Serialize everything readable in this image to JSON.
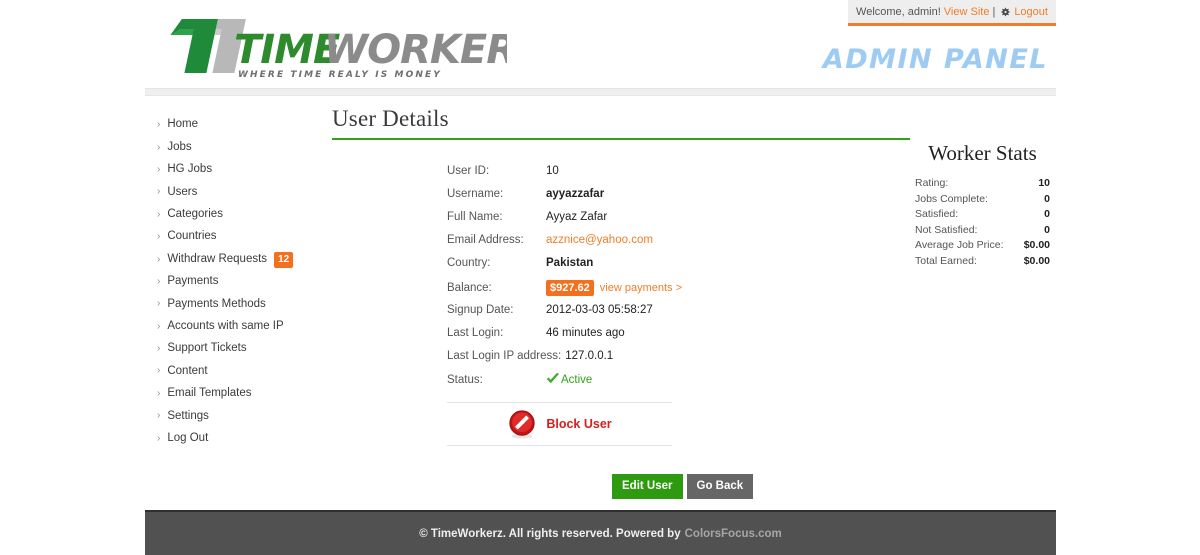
{
  "topbar": {
    "welcome_text": "Welcome, admin!",
    "view_site_label": "View Site",
    "separator": "|",
    "logout_icon": "puzzle-icon",
    "logout_label": "Logout",
    "accent_color": "#f07d28"
  },
  "brand": {
    "logo_primary": "TIME",
    "logo_secondary": "WORKERZ",
    "tagline": "WHERE TIME REALY IS MONEY",
    "primary_color": "#2d8b2d",
    "secondary_color": "#8b8b8b",
    "admin_panel_label": "ADMIN PANEL",
    "admin_panel_color": "#9ecbf2"
  },
  "sidebar": {
    "items": [
      {
        "label": "Home",
        "badge": null
      },
      {
        "label": "Jobs",
        "badge": null
      },
      {
        "label": "HG Jobs",
        "badge": null
      },
      {
        "label": "Users",
        "badge": null
      },
      {
        "label": "Categories",
        "badge": null
      },
      {
        "label": "Countries",
        "badge": null
      },
      {
        "label": "Withdraw Requests",
        "badge": "12"
      },
      {
        "label": "Payments",
        "badge": null
      },
      {
        "label": "Payments Methods",
        "badge": null
      },
      {
        "label": "Accounts with same IP",
        "badge": null
      },
      {
        "label": "Support Tickets",
        "badge": null
      },
      {
        "label": "Content",
        "badge": null
      },
      {
        "label": "Email Templates",
        "badge": null
      },
      {
        "label": "Settings",
        "badge": null
      },
      {
        "label": "Log Out",
        "badge": null
      }
    ],
    "bullet": "›",
    "badge_color": "#f4701e"
  },
  "main": {
    "title": "User Details",
    "title_rule_color": "#2fa318",
    "fields": [
      {
        "label": "User ID:",
        "value": "10",
        "style": "plain"
      },
      {
        "label": "Username:",
        "value": "ayyazzafar",
        "style": "bold"
      },
      {
        "label": "Full Name:",
        "value": "Ayyaz Zafar",
        "style": "plain"
      },
      {
        "label": "Email Address:",
        "value": "azznice@yahoo.com",
        "style": "email"
      },
      {
        "label": "Country:",
        "value": "Pakistan",
        "style": "bold"
      },
      {
        "label": "Signup Date:",
        "value": "2012-03-03 05:58:27",
        "style": "plain"
      },
      {
        "label": "Last Login:",
        "value": "46 minutes ago",
        "style": "plain"
      },
      {
        "label": "Last Login IP address:",
        "value": "127.0.0.1",
        "style": "plain"
      }
    ],
    "balance": {
      "label": "Balance:",
      "amount": "$927.62",
      "link_label": "view payments >",
      "badge_color": "#f4701e"
    },
    "status": {
      "label": "Status:",
      "value": "Active",
      "icon": "green-check-icon",
      "color": "#2fa318"
    },
    "block_user": {
      "label": "Block User",
      "icon": "no-entry-icon",
      "color": "#d61f1f"
    },
    "buttons": {
      "edit_label": "Edit User",
      "back_label": "Go Back",
      "edit_color": "#2d9a0f",
      "back_color": "#666666"
    }
  },
  "worker_stats": {
    "title": "Worker Stats",
    "rows": [
      {
        "label": "Rating:",
        "value": "10"
      },
      {
        "label": "Jobs Complete:",
        "value": "0"
      },
      {
        "label": "Satisfied:",
        "value": "0"
      },
      {
        "label": "Not Satisfied:",
        "value": "0"
      },
      {
        "label": "Average Job Price:",
        "value": "$0.00"
      },
      {
        "label": "Total Earned:",
        "value": "$0.00"
      }
    ]
  },
  "footer": {
    "text": "© TimeWorkerz. All rights reserved. Powered by",
    "credit": "ColorsFocus.com"
  }
}
